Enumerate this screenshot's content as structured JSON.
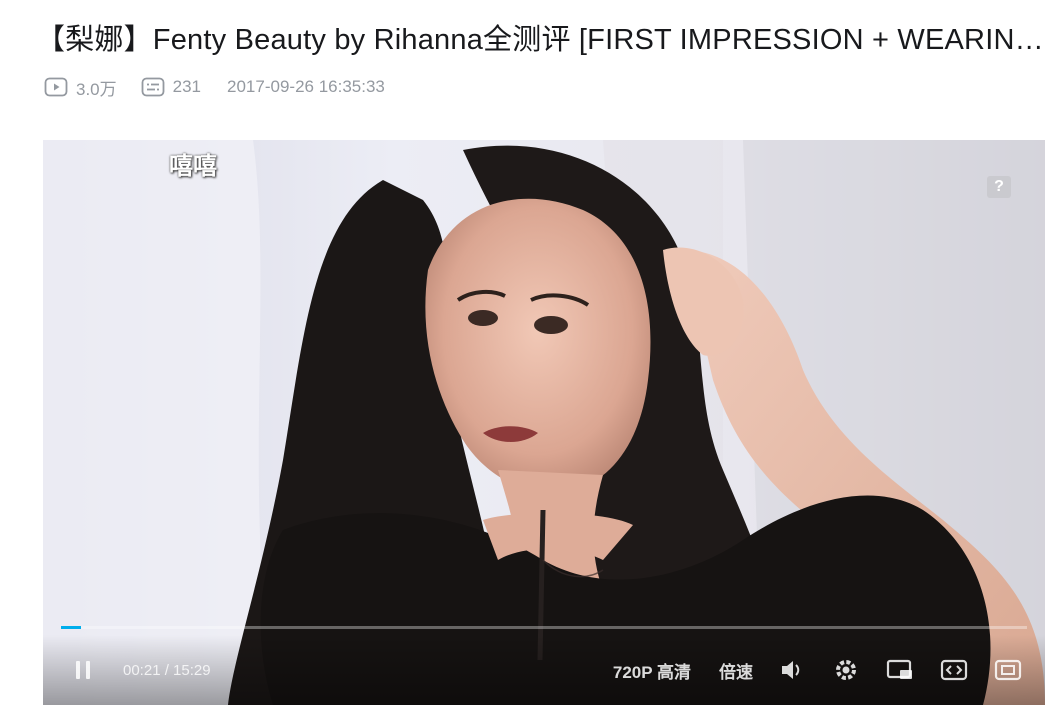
{
  "video": {
    "title": "【梨娜】Fenty Beauty by Rihanna全测评 [FIRST IMPRESSION + WEARIN…",
    "views": "3.0万",
    "danmaku_count": "231",
    "published": "2017-09-26 16:35:33"
  },
  "player": {
    "danmaku_text": "嘻嘻",
    "help_label": "?",
    "progress": 0.021,
    "time_display": "00:21 / 15:29",
    "quality_label": "720P 高清",
    "speed_label": "倍速"
  },
  "icons": {
    "views": "play-count-icon",
    "danmaku": "danmaku-count-icon",
    "pause": "pause-icon",
    "volume": "volume-icon",
    "settings": "gear-icon",
    "pip": "picture-in-picture-icon",
    "widescreen": "widescreen-icon",
    "fullscreen": "fullscreen-icon"
  },
  "colors": {
    "accent": "#00aeec",
    "meta": "#9499a0",
    "title": "#18191c"
  }
}
